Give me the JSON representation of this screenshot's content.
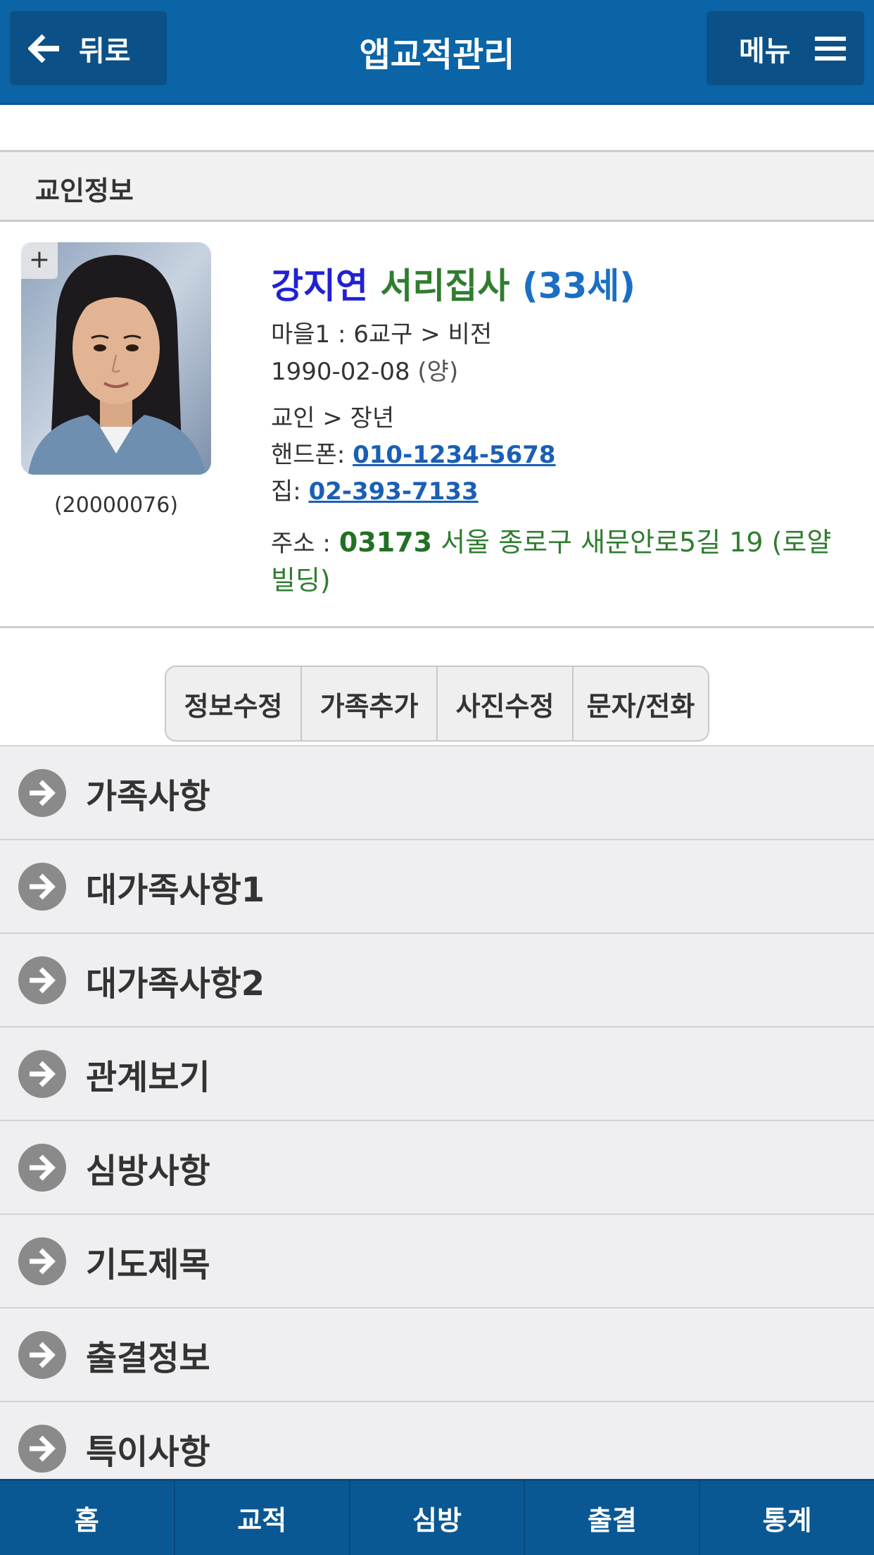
{
  "header": {
    "back_label": "뒤로",
    "title": "앱교적관리",
    "menu_label": "메뉴"
  },
  "section": {
    "title": "교인정보"
  },
  "profile": {
    "photo_add": "+",
    "member_id": "(20000076)",
    "name": "강지연",
    "rank": "서리집사",
    "age": "(33세)",
    "group": "마을1 : 6교구 > 비전",
    "birth_date": "1990-02-08",
    "calendar": "(양)",
    "member_type": "교인 > 장년",
    "mobile_label": "핸드폰:",
    "mobile": "010-1234-5678",
    "home_label": "집:",
    "home": "02-393-7133",
    "address_label": "주소 :",
    "zip": "03173",
    "address": "서울 종로구 새문안로5길 19 (로얄빌딩)"
  },
  "actions": [
    "정보수정",
    "가족추가",
    "사진수정",
    "문자/전화"
  ],
  "list_items": [
    "가족사항",
    "대가족사항1",
    "대가족사항2",
    "관계보기",
    "심방사항",
    "기도제목",
    "출결정보",
    "특이사항"
  ],
  "tabs": [
    "홈",
    "교적",
    "심방",
    "출결",
    "통계"
  ],
  "colors": {
    "header": "#0a64a5",
    "name": "#2121d4",
    "rank": "#2f7d2f",
    "age": "#1a6fc5",
    "address": "#2f7d2f",
    "tabbar": "#0a5893"
  }
}
